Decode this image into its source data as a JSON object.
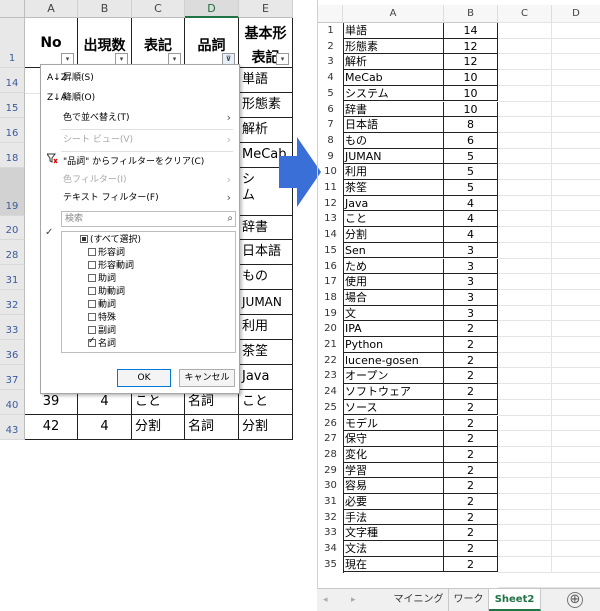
{
  "left_sheet": {
    "columns": [
      "A",
      "B",
      "C",
      "D",
      "E"
    ],
    "header_cells": [
      "No",
      "出現数",
      "表記",
      "品詞",
      "基本形表記"
    ],
    "header_row_number": "1",
    "row_numbers": [
      "14",
      "15",
      "16",
      "18",
      "19",
      "20",
      "28",
      "31",
      "32",
      "33",
      "36",
      "37",
      "40",
      "43"
    ],
    "column_e_values": [
      "単語",
      "形態素",
      "解析",
      "MeCab",
      "シ",
      "ム",
      "辞書",
      "日本語",
      "もの",
      "JUMAN",
      "利用",
      "茶筌",
      "Java",
      "こと",
      "分割"
    ],
    "row_40": [
      "39",
      "4",
      "こと",
      "名詞"
    ],
    "row_43": [
      "42",
      "4",
      "分割",
      "名詞"
    ],
    "filter_button": "▾",
    "filter_button_active": "⊽"
  },
  "dropdown": {
    "sort_asc": "昇順(S)",
    "sort_desc": "降順(O)",
    "sort_by_color": "色で並べ替え(T)",
    "sheet_view": "シート ビュー(V)",
    "clear_filter": "\"品詞\" からフィルターをクリア(C)",
    "color_filter": "色フィルター(I)",
    "text_filter": "テキスト フィルター(F)",
    "search_placeholder": "検索",
    "values": [
      "(すべて選択)",
      "形容詞",
      "形容動詞",
      "助詞",
      "助動詞",
      "動詞",
      "特殊",
      "副詞",
      "名詞"
    ],
    "ok": "OK",
    "cancel": "キャンセル"
  },
  "right_sheet": {
    "columns": [
      "A",
      "B",
      "C",
      "D"
    ],
    "rows": [
      [
        "単語",
        "14"
      ],
      [
        "形態素",
        "12"
      ],
      [
        "解析",
        "12"
      ],
      [
        "MeCab",
        "10"
      ],
      [
        "システム",
        "10"
      ],
      [
        "辞書",
        "10"
      ],
      [
        "日本語",
        "8"
      ],
      [
        "もの",
        "6"
      ],
      [
        "JUMAN",
        "5"
      ],
      [
        "利用",
        "5"
      ],
      [
        "茶筌",
        "5"
      ],
      [
        "Java",
        "4"
      ],
      [
        "こと",
        "4"
      ],
      [
        "分割",
        "4"
      ],
      [
        "Sen",
        "3"
      ],
      [
        "ため",
        "3"
      ],
      [
        "使用",
        "3"
      ],
      [
        "場合",
        "3"
      ],
      [
        "文",
        "3"
      ],
      [
        "IPA",
        "2"
      ],
      [
        "Python",
        "2"
      ],
      [
        "lucene-gosen",
        "2"
      ],
      [
        "オープン",
        "2"
      ],
      [
        "ソフトウェア",
        "2"
      ],
      [
        "ソース",
        "2"
      ],
      [
        "モデル",
        "2"
      ],
      [
        "保守",
        "2"
      ],
      [
        "変化",
        "2"
      ],
      [
        "学習",
        "2"
      ],
      [
        "容易",
        "2"
      ],
      [
        "必要",
        "2"
      ],
      [
        "手法",
        "2"
      ],
      [
        "文字種",
        "2"
      ],
      [
        "文法",
        "2"
      ],
      [
        "現在",
        "2"
      ]
    ],
    "tabs": [
      "マイニング",
      "ワーク",
      "Sheet2"
    ],
    "add_sheet": "⊕",
    "nav_prev": "◂",
    "nav_next": "▸"
  },
  "icons": [
    "sort-ascending-icon",
    "sort-descending-icon",
    "clear-filter-icon",
    "search-icon",
    "right-arrow-icon",
    "add-sheet-icon"
  ],
  "colors": {
    "accent": "#217346",
    "arrow": "#3a6fd8",
    "row_header_text": "#3b5a9a"
  }
}
